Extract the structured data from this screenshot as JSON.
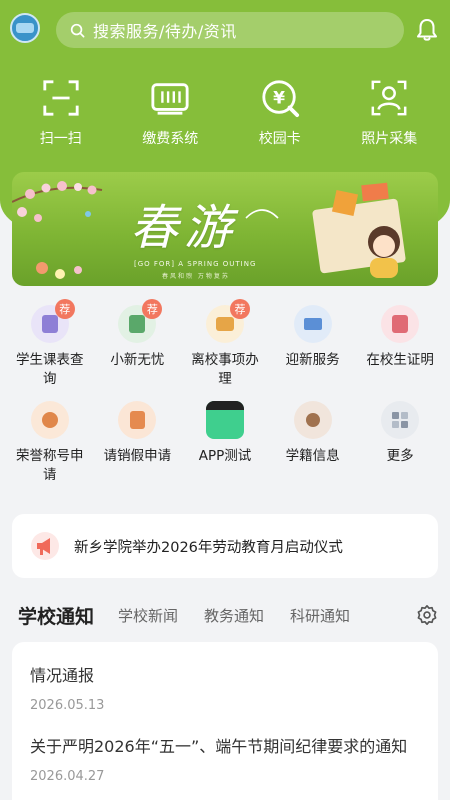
{
  "header": {
    "search_placeholder": "搜索服务/待办/资讯"
  },
  "quick_actions": [
    {
      "label": "扫一扫",
      "icon": "scan-icon"
    },
    {
      "label": "缴费系统",
      "icon": "payment-icon"
    },
    {
      "label": "校园卡",
      "icon": "campus-card-icon"
    },
    {
      "label": "照片采集",
      "icon": "photo-capture-icon"
    }
  ],
  "banner": {
    "title": "春游",
    "subtitle": "[GO FOR] A SPRING OUTING",
    "subtitle2": "春风和煦 万物复苏"
  },
  "services": [
    {
      "label": "学生课表查询",
      "badge": "荐",
      "color": "#8e7fd6",
      "icon": "timetable-icon"
    },
    {
      "label": "小新无忧",
      "badge": "荐",
      "color": "#5aa86a",
      "icon": "assistant-icon"
    },
    {
      "label": "离校事项办理",
      "badge": "荐",
      "color": "#e6a547",
      "icon": "leave-school-icon"
    },
    {
      "label": "迎新服务",
      "badge": "",
      "color": "#5b8fd6",
      "icon": "welcome-icon"
    },
    {
      "label": "在校生证明",
      "badge": "",
      "color": "#e06b75",
      "icon": "certificate-icon"
    },
    {
      "label": "荣誉称号申请",
      "badge": "",
      "color": "#e0874a",
      "icon": "honor-icon"
    },
    {
      "label": "请销假申请",
      "badge": "",
      "color": "#e58a4f",
      "icon": "leave-request-icon"
    },
    {
      "label": "APP测试",
      "badge": "",
      "color": "#3fcf8e",
      "icon": "clapperboard-icon"
    },
    {
      "label": "学籍信息",
      "badge": "",
      "color": "#a0724f",
      "icon": "student-info-icon"
    },
    {
      "label": "更多",
      "badge": "",
      "color": "#8a95a5",
      "icon": "more-icon"
    }
  ],
  "notice": {
    "text": "新乡学院举办2026年劳动教育月启动仪式"
  },
  "tabs": {
    "main": "学校通知",
    "items": [
      "学校新闻",
      "教务通知",
      "科研通知"
    ]
  },
  "news": [
    {
      "title": "情况通报",
      "date": "2026.05.13"
    },
    {
      "title": "关于严明2026年“五一”、端午节期间纪律要求的通知",
      "date": "2026.04.27"
    }
  ],
  "colors": {
    "brand_green": "#86be3a",
    "badge": "#f2775f"
  }
}
